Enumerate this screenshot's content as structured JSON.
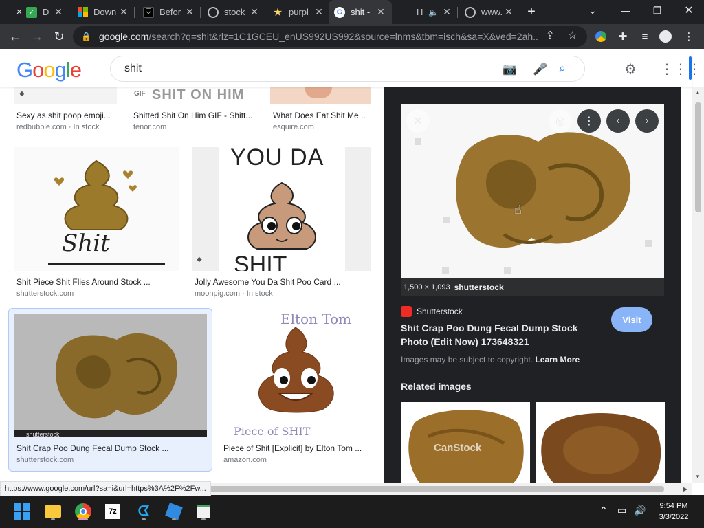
{
  "tabs": [
    {
      "title": "D",
      "active": false
    },
    {
      "title": "Down",
      "active": false
    },
    {
      "title": "Befor",
      "active": false
    },
    {
      "title": "stock",
      "active": false
    },
    {
      "title": "purpl",
      "active": false
    },
    {
      "title": "shit -",
      "active": true
    },
    {
      "title": "H",
      "active": false
    },
    {
      "title": "www.",
      "active": false
    }
  ],
  "address": {
    "host": "google.com",
    "path": "/search?q=shit&rlz=1C1GCEU_enUS992US992&source=lnms&tbm=isch&sa=X&ved=2ah..."
  },
  "search": {
    "logo": "Google",
    "query": "shit"
  },
  "results": {
    "top_row": [
      {
        "caption": "Sexy as shit poop emoji...",
        "source": "redbubble.com · In stock"
      },
      {
        "caption": "Shitted Shit On Him GIF - Shitt...",
        "source": "tenor.com",
        "image_text": "SHIT ON HIM"
      },
      {
        "caption": "What Does Eat Shit Me...",
        "source": "esquire.com"
      }
    ],
    "middle_row": [
      {
        "caption": "Shit Piece Shit Flies Around Stock ...",
        "source": "shutterstock.com",
        "image_text": "Shit"
      },
      {
        "caption": "Jolly Awesome You Da Shit Poo Card ...",
        "source": "moonpig.com · In stock",
        "image_text_top": "YOU DA",
        "image_text_bottom": "SHIT"
      }
    ],
    "bottom_row": [
      {
        "caption": "Shit Crap Poo Dung Fecal Dump Stock ...",
        "source": "shutterstock.com",
        "image_text": "shutterstock"
      },
      {
        "caption": "Piece of Shit [Explicit] by Elton Tom ...",
        "source": "amazon.com",
        "image_text_top": "Elton Tom",
        "image_text_bottom": "Piece of SHIT"
      }
    ]
  },
  "preview": {
    "dimensions": "1,500 × 1,093",
    "watermark": "shutterstock",
    "site": "Shutterstock",
    "title": "Shit Crap Poo Dung Fecal Dump Stock Photo (Edit Now) 173648321",
    "visit_label": "Visit",
    "copyright": "Images may be subject to copyright.",
    "learn_more": "Learn More",
    "related_heading": "Related images",
    "related_watermark": "CanStock"
  },
  "status_url": "https://www.google.com/url?sa=i&url=https%3A%2F%2Fw...",
  "clock": {
    "time": "9:54 PM",
    "date": "3/3/2022"
  },
  "colors": {
    "accent": "#1a73e8",
    "visit": "#8ab4f8",
    "panel": "#202124",
    "shutterstock": "#ee2b24"
  }
}
